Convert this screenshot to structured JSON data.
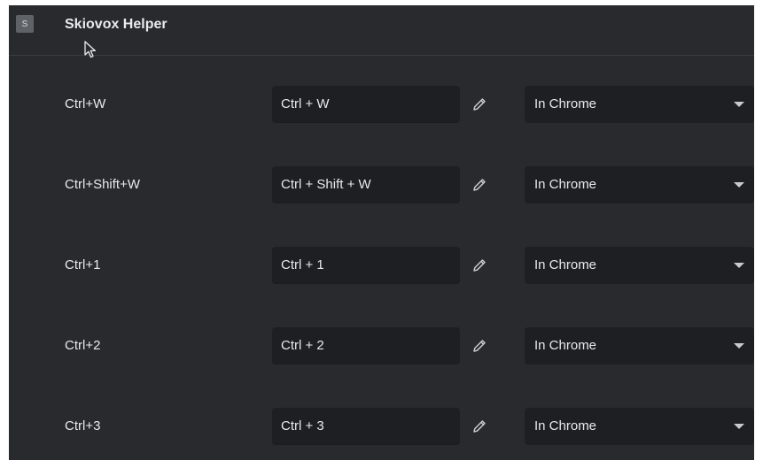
{
  "extension": {
    "icon_letter": "S",
    "name": "Skiovox Helper"
  },
  "shortcuts": [
    {
      "command": "Ctrl+W",
      "shortcut": "Ctrl + W",
      "scope": "In Chrome"
    },
    {
      "command": "Ctrl+Shift+W",
      "shortcut": "Ctrl + Shift + W",
      "scope": "In Chrome"
    },
    {
      "command": "Ctrl+1",
      "shortcut": "Ctrl + 1",
      "scope": "In Chrome"
    },
    {
      "command": "Ctrl+2",
      "shortcut": "Ctrl + 2",
      "scope": "In Chrome"
    },
    {
      "command": "Ctrl+3",
      "shortcut": "Ctrl + 3",
      "scope": "In Chrome"
    }
  ],
  "icons": {
    "edit": "pencil-icon",
    "dropdown": "caret-down-icon",
    "pointer": "mouse-cursor-icon"
  },
  "colors": {
    "panel_background": "#292a2d",
    "field_background": "#1e1f22",
    "text": "#e8eaed",
    "icon_badge": "#5f6368"
  }
}
